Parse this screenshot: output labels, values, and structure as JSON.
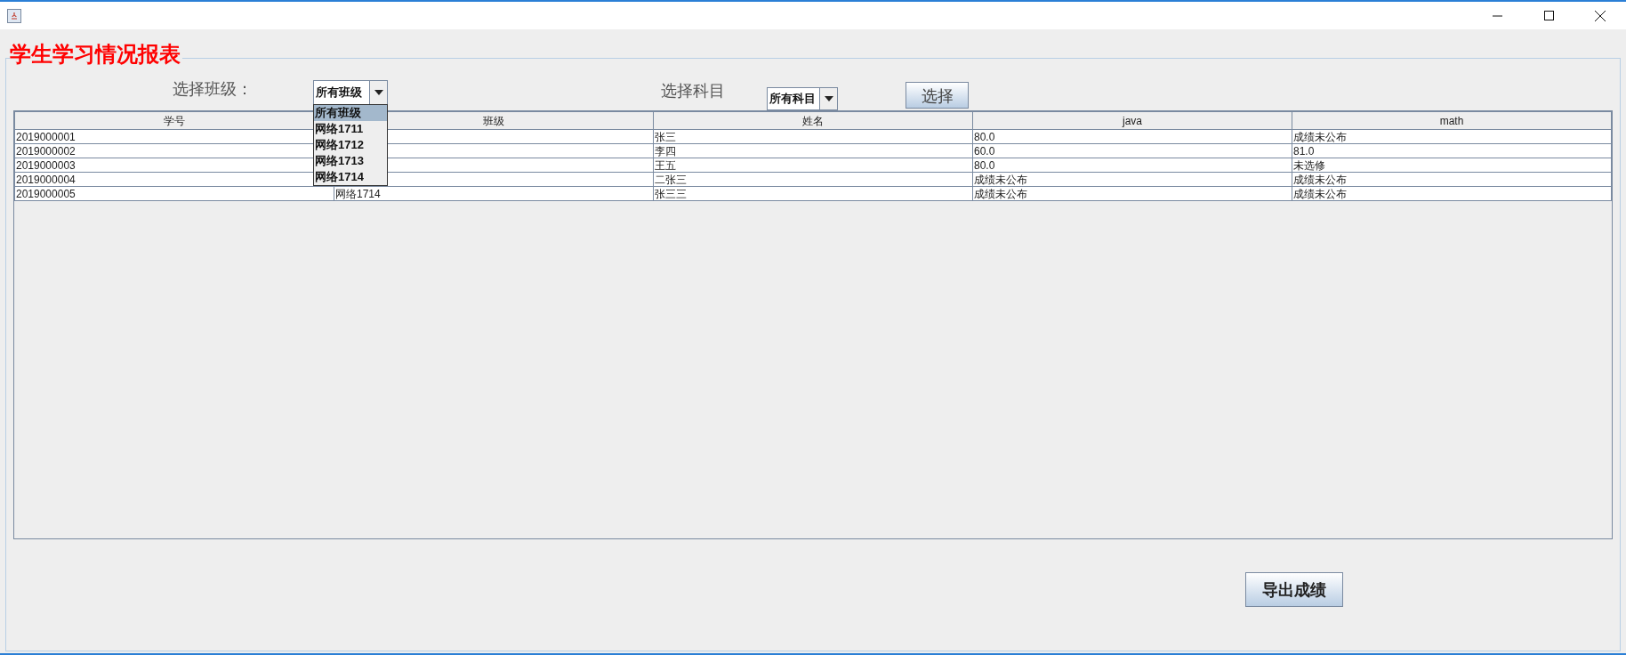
{
  "panel": {
    "title": "学生学习情况报表"
  },
  "class_filter": {
    "label": "选择班级：",
    "value": "所有班级",
    "expanded": true,
    "options": [
      {
        "label": "所有班级",
        "selected": true
      },
      {
        "label": "网络1711",
        "selected": false
      },
      {
        "label": "网络1712",
        "selected": false
      },
      {
        "label": "网络1713",
        "selected": false
      },
      {
        "label": "网络1714",
        "selected": false
      }
    ]
  },
  "subject_filter": {
    "label": "选择科目",
    "value": "所有科目"
  },
  "select_button": "选择",
  "table": {
    "columns": [
      "学号",
      "班级",
      "姓名",
      "java",
      "math"
    ],
    "rows": [
      {
        "cells": [
          "2019000001",
          null,
          "张三",
          "80.0",
          "成绩未公布"
        ]
      },
      {
        "cells": [
          "2019000002",
          null,
          "李四",
          "60.0",
          "81.0"
        ]
      },
      {
        "cells": [
          "2019000003",
          null,
          "王五",
          "80.0",
          "未选修"
        ]
      },
      {
        "cells": [
          "2019000004",
          null,
          "二张三",
          "成绩未公布",
          "成绩未公布"
        ]
      },
      {
        "cells": [
          "2019000005",
          "网络1714",
          "张三三",
          "成绩未公布",
          "成绩未公布"
        ]
      }
    ]
  },
  "export_button": "导出成绩"
}
